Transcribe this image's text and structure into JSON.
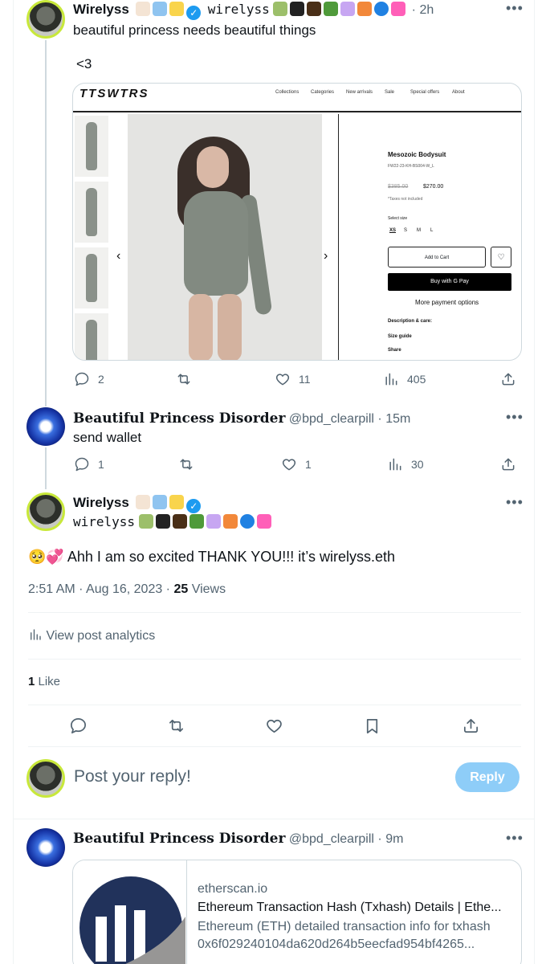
{
  "tweet1": {
    "name": "Wirelyss",
    "handle": "wirelyss",
    "time": "2h",
    "line1": "beautiful princess needs beautiful things",
    "line2": "<3",
    "replies": "2",
    "likes": "11",
    "views": "405",
    "embed": {
      "logo": "TTSWTRS",
      "nav": [
        "Collections",
        "Categories",
        "New arrivals",
        "Sale",
        "Special offers",
        "About"
      ],
      "product_name": "Mesozoic Bodysuit",
      "sku": "FW22-23-KH-BS004-W_L",
      "old_price": "$385.00",
      "price": "$270.00",
      "tax_note": "*Taxes not included",
      "size_label": "Select size",
      "sizes": [
        "XS",
        "S",
        "M",
        "L"
      ],
      "add_to_cart": "Add to Cart",
      "gpay": "Buy with G Pay",
      "more_payment": "More payment options",
      "description": "Description & care:",
      "size_guide": "Size guide",
      "share": "Share"
    }
  },
  "tweet2": {
    "name": "Beautiful Princess Disorder",
    "handle": "@bpd_clearpill",
    "time": "15m",
    "text": "send wallet",
    "replies": "1",
    "likes": "1",
    "views": "30"
  },
  "tweet3": {
    "name": "Wirelyss",
    "handle": "wirelyss",
    "text": "🥺💞 Ahh I am so excited THANK YOU!!! it’s wirelyss.eth",
    "timestamp": "2:51 AM · Aug 16, 2023 · ",
    "views_count": "25",
    "views_label": " Views",
    "analytics": "View post analytics",
    "likes_count": "1",
    "likes_label": " Like"
  },
  "reply_box": {
    "placeholder": "Post your reply!",
    "button": "Reply"
  },
  "tweet4": {
    "name": "Beautiful Princess Disorder",
    "handle": "@bpd_clearpill",
    "time": "9m",
    "card_domain": "etherscan.io",
    "card_title": "Ethereum Transaction Hash (Txhash) Details | Ethe...",
    "card_desc1": "Ethereum (ETH) detailed transaction info for txhash",
    "card_desc2": "0x6f029240104da620d264b5eecfad954bf4265..."
  },
  "colors": {
    "accent": "#1d9bf0",
    "reply_button": "#8ecdf8",
    "text_secondary": "#536471"
  }
}
